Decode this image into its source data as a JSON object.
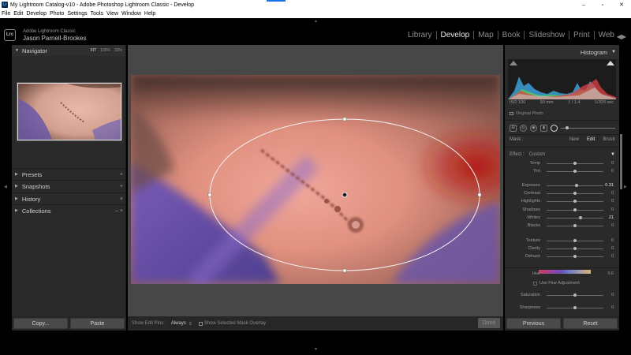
{
  "window": {
    "title": "My Lightroom Catalog-v10 - Adobe Photoshop Lightroom Classic - Develop",
    "minimize": "–",
    "maximize": "▫",
    "close": "✕"
  },
  "menubar": [
    "File",
    "Edit",
    "Develop",
    "Photo",
    "Settings",
    "Tools",
    "View",
    "Window",
    "Help"
  ],
  "identity": {
    "logo": "Lrc",
    "app_line": "Adobe Lightroom Classic",
    "user_name": "Jason Parnell-Brookes"
  },
  "modules": [
    "Library",
    "Develop",
    "Map",
    "Book",
    "Slideshow",
    "Print",
    "Web"
  ],
  "active_module": "Develop",
  "navigator": {
    "title": "Navigator",
    "zoom_options": [
      "FIT",
      "100%",
      "33%"
    ]
  },
  "left_sections": [
    {
      "label": "Presets",
      "action": "+"
    },
    {
      "label": "Snapshots",
      "action": "+"
    },
    {
      "label": "History",
      "action": "×"
    },
    {
      "label": "Collections",
      "action": "– +"
    }
  ],
  "left_buttons": {
    "copy": "Copy...",
    "paste": "Paste"
  },
  "toolbar": {
    "edit_pins_label": "Show Edit Pins :",
    "edit_pins_value": "Always",
    "mask_overlay_label": "Show Selected Mask Overlay",
    "done_label": "Done"
  },
  "histogram": {
    "title": "Histogram",
    "iso": "ISO 100",
    "focal": "50 mm",
    "aperture": "ƒ / 1.4",
    "shutter": "1/320 sec",
    "original_photo": "Original Photo"
  },
  "mask": {
    "label": "Mask :",
    "options": [
      "New",
      "Edit",
      "Brush"
    ],
    "active": "Edit",
    "effect_label": "Effect :",
    "effect_value": "Custom"
  },
  "sliders": [
    {
      "label": "Temp",
      "value": "0",
      "pos": 0.5
    },
    {
      "label": "Tint",
      "value": "0",
      "pos": 0.5
    },
    {
      "label": "Exposure",
      "value": "0.31",
      "pos": 0.53,
      "hi": true
    },
    {
      "label": "Contrast",
      "value": "0",
      "pos": 0.5
    },
    {
      "label": "Highlights",
      "value": "0",
      "pos": 0.5
    },
    {
      "label": "Shadows",
      "value": "0",
      "pos": 0.5
    },
    {
      "label": "Whites",
      "value": "21",
      "pos": 0.6,
      "hi": true
    },
    {
      "label": "Blacks",
      "value": "0",
      "pos": 0.5
    },
    {
      "label": "Texture",
      "value": "0",
      "pos": 0.5
    },
    {
      "label": "Clarity",
      "value": "0",
      "pos": 0.5
    },
    {
      "label": "Dehaze",
      "value": "0",
      "pos": 0.5
    }
  ],
  "hue": {
    "label": "Hue",
    "value": "0.0",
    "fine_label": "Use Fine Adjustment"
  },
  "lower_sliders": [
    {
      "label": "Saturation",
      "value": "0",
      "pos": 0.5
    },
    {
      "label": "Sharpness",
      "value": "0",
      "pos": 0.5
    }
  ],
  "right_buttons": {
    "previous": "Previous",
    "reset": "Reset"
  },
  "colors": {
    "panel_bg": "#2a2a2a",
    "canvas_bg": "#474747",
    "highlight_text": "#e6e6e6"
  }
}
